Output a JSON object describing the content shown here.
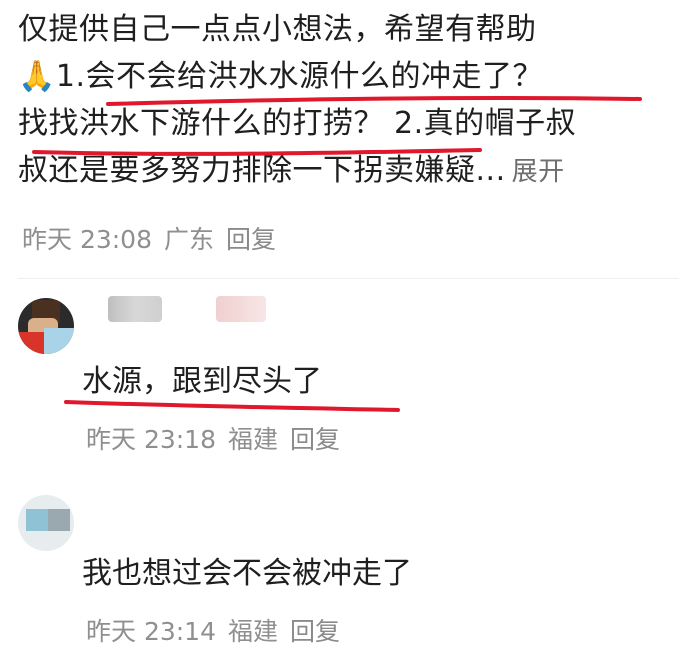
{
  "main_comment": {
    "line1": "仅提供自己一点点小想法，希望有帮助",
    "line2_emoji": "🙏",
    "line2_text": "1.会不会给洪水水源什么的冲走了？",
    "line3": "找找洪水下游什么的打捞？ 2.真的帽子叔",
    "line4": "叔还是要多努力排除一下拐卖嫌疑...",
    "expand_label": "展开",
    "time": "昨天 23:08",
    "location": "广东",
    "reply_label": "回复"
  },
  "replies": [
    {
      "text": "水源，跟到尽头了",
      "time": "昨天 23:18",
      "location": "福建",
      "reply_label": "回复"
    },
    {
      "text": "我也想过会不会被冲走了",
      "time": "昨天 23:14",
      "location": "福建",
      "reply_label": "回复"
    }
  ],
  "colors": {
    "text": "#1f1f1f",
    "meta": "#8f8f8f",
    "underline": "#e0182d"
  }
}
